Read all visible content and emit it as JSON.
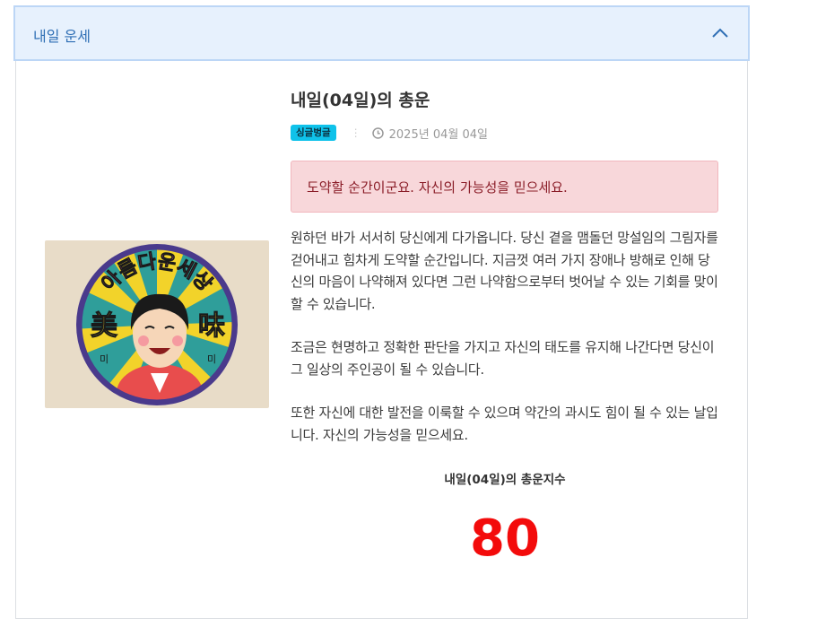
{
  "accordion": {
    "title": "내일 운세"
  },
  "fortune": {
    "heading": "내일(04일)의 총운",
    "badge": "싱글벙글",
    "date": "2025년 04월 04일",
    "alert": "도약할 순간이군요. 자신의 가능성을 믿으세요.",
    "paragraphs": [
      "원하던 바가 서서히 당신에게 다가옵니다. 당신 곁을 맴돌던 망설임의 그림자를 걷어내고 힘차게 도약할 순간입니다. 지금껏 여러 가지 장애나 방해로 인해 당신의 마음이 나약해져 있다면 그런 나약함으로부터 벗어날 수 있는 기회를 맞이할 수 있습니다.",
      "조금은 현명하고 정확한 판단을 가지고 자신의 태도를 유지해 나간다면 당신이 그 일상의 주인공이 될 수 있습니다.",
      "또한 자신에 대한 발전을 이룩할 수 있으며 약간의 과시도 힘이 될 수 있는 날입니다. 자신의 가능성을 믿으세요."
    ],
    "score_label": "내일(04일)의 총운지수",
    "score": "80"
  },
  "logo": {
    "arc_text": "아름다운세상",
    "left_char": "美",
    "right_char": "味",
    "left_sub": "미",
    "right_sub": "미"
  },
  "colors": {
    "header_bg": "#e7f1fd",
    "header_text": "#2f6fb5",
    "badge_bg": "#0fc2ea",
    "alert_bg": "#f8d7da",
    "alert_text": "#8a1c27",
    "score": "#f30b0b"
  },
  "icons": [
    "chevron-up-icon",
    "clock-icon"
  ]
}
